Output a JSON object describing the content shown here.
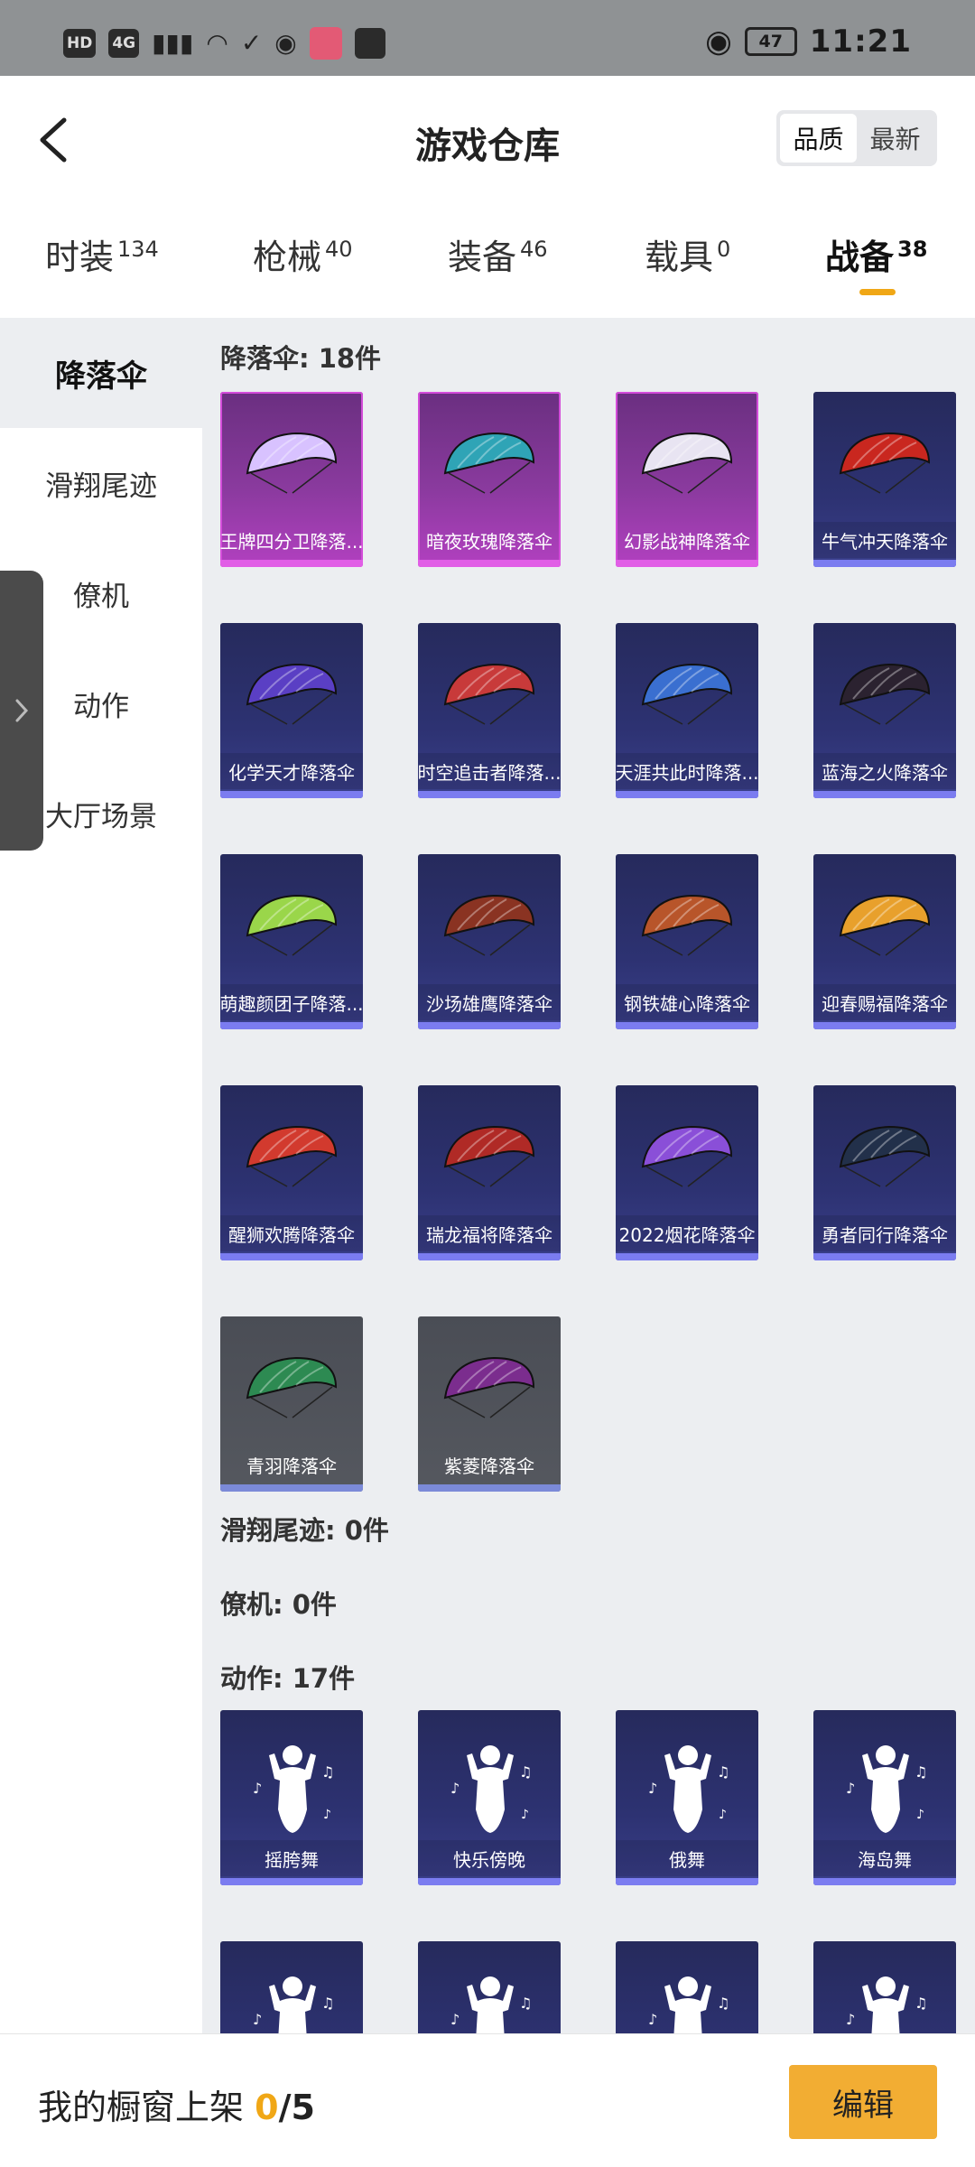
{
  "status_bar": {
    "left": [
      "HD",
      "4G"
    ],
    "battery": "47",
    "time": "11:21"
  },
  "header": {
    "title": "游戏仓库",
    "sort_options": [
      "品质",
      "最新"
    ]
  },
  "tabs": [
    {
      "label": "时装",
      "count": "134"
    },
    {
      "label": "枪械",
      "count": "40"
    },
    {
      "label": "装备",
      "count": "46"
    },
    {
      "label": "载具",
      "count": "0"
    },
    {
      "label": "战备",
      "count": "38"
    }
  ],
  "categories": [
    "降落伞",
    "滑翔尾迹",
    "僚机",
    "动作",
    "大厅场景"
  ],
  "sections": {
    "parachute_title": "降落伞: 18件",
    "trail_title": "滑翔尾迹: 0件",
    "wingman_title": "僚机: 0件",
    "emote_title": "动作: 17件"
  },
  "parachutes": [
    {
      "name": "王牌四分卫降落...",
      "rarity": "epic",
      "color": "#d8c2ff"
    },
    {
      "name": "暗夜玫瑰降落伞",
      "rarity": "epic",
      "color": "#2fa4b6"
    },
    {
      "name": "幻影战神降落伞",
      "rarity": "epic",
      "color": "#e8e4f2"
    },
    {
      "name": "牛气冲天降落伞",
      "rarity": "rare",
      "color": "#c9271f"
    },
    {
      "name": "化学天才降落伞",
      "rarity": "rare",
      "color": "#5a3fc4"
    },
    {
      "name": "时空追击者降落...",
      "rarity": "rare",
      "color": "#c83a3a"
    },
    {
      "name": "天涯共此时降落...",
      "rarity": "rare",
      "color": "#3a6fd0"
    },
    {
      "name": "蓝海之火降落伞",
      "rarity": "rare",
      "color": "#2b2230"
    },
    {
      "name": "萌趣颜团子降落...",
      "rarity": "rare",
      "color": "#9ad64a"
    },
    {
      "name": "沙场雄鹰降落伞",
      "rarity": "rare",
      "color": "#8a3322"
    },
    {
      "name": "钢铁雄心降落伞",
      "rarity": "rare",
      "color": "#b8552a"
    },
    {
      "name": "迎春赐福降落伞",
      "rarity": "rare",
      "color": "#e8a02c"
    },
    {
      "name": "醒狮欢腾降落伞",
      "rarity": "rare",
      "color": "#d23a2e"
    },
    {
      "name": "瑞龙福将降落伞",
      "rarity": "rare",
      "color": "#b02a26"
    },
    {
      "name": "2022烟花降落伞",
      "rarity": "rare",
      "color": "#8a4fd8"
    },
    {
      "name": "勇者同行降落伞",
      "rarity": "rare",
      "color": "#22304a"
    },
    {
      "name": "青羽降落伞",
      "rarity": "common",
      "color": "#2d8a52"
    },
    {
      "name": "紫菱降落伞",
      "rarity": "common",
      "color": "#7b2d8e"
    }
  ],
  "emotes": [
    {
      "name": "摇胯舞"
    },
    {
      "name": "快乐傍晚"
    },
    {
      "name": "俄舞"
    },
    {
      "name": "海岛舞"
    },
    {
      "name": ""
    },
    {
      "name": ""
    },
    {
      "name": ""
    },
    {
      "name": ""
    }
  ],
  "bottom": {
    "showcase_label": "我的橱窗上架",
    "current": "0",
    "slash": "/",
    "max": "5",
    "edit_label": "编辑"
  },
  "colors": {
    "accent": "#f0a716",
    "epic": "#b240c0",
    "rare": "#2d3272",
    "common": "#55585f"
  }
}
